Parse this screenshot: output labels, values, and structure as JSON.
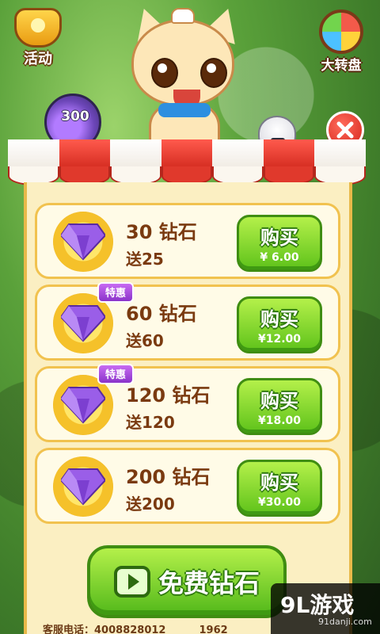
{
  "hud": {
    "event_label": "活动",
    "wheel_label": "大转盘",
    "jar_count": "300"
  },
  "packages": [
    {
      "qty": "30 钻石",
      "bonus": "送25",
      "badge": "",
      "buy": "购买",
      "price": "¥ 6.00"
    },
    {
      "qty": "60 钻石",
      "bonus": "送60",
      "badge": "特惠",
      "buy": "购买",
      "price": "¥12.00"
    },
    {
      "qty": "120 钻石",
      "bonus": "送120",
      "badge": "特惠",
      "buy": "购买",
      "price": "¥18.00"
    },
    {
      "qty": "200 钻石",
      "bonus": "送200",
      "badge": "",
      "buy": "购买",
      "price": "¥30.00"
    }
  ],
  "free_button": {
    "label": "免费钻石"
  },
  "footer": {
    "service_label": "客服电话：",
    "phone": "4008828012",
    "phone2": "1962"
  },
  "watermark": {
    "main": "9L游戏",
    "sub": "91danji.com"
  },
  "colors": {
    "accent_green": "#5ec21a",
    "accent_red": "#d62e22",
    "panel_bg": "#fbefc2",
    "gem_purple": "#8a4bdc"
  }
}
